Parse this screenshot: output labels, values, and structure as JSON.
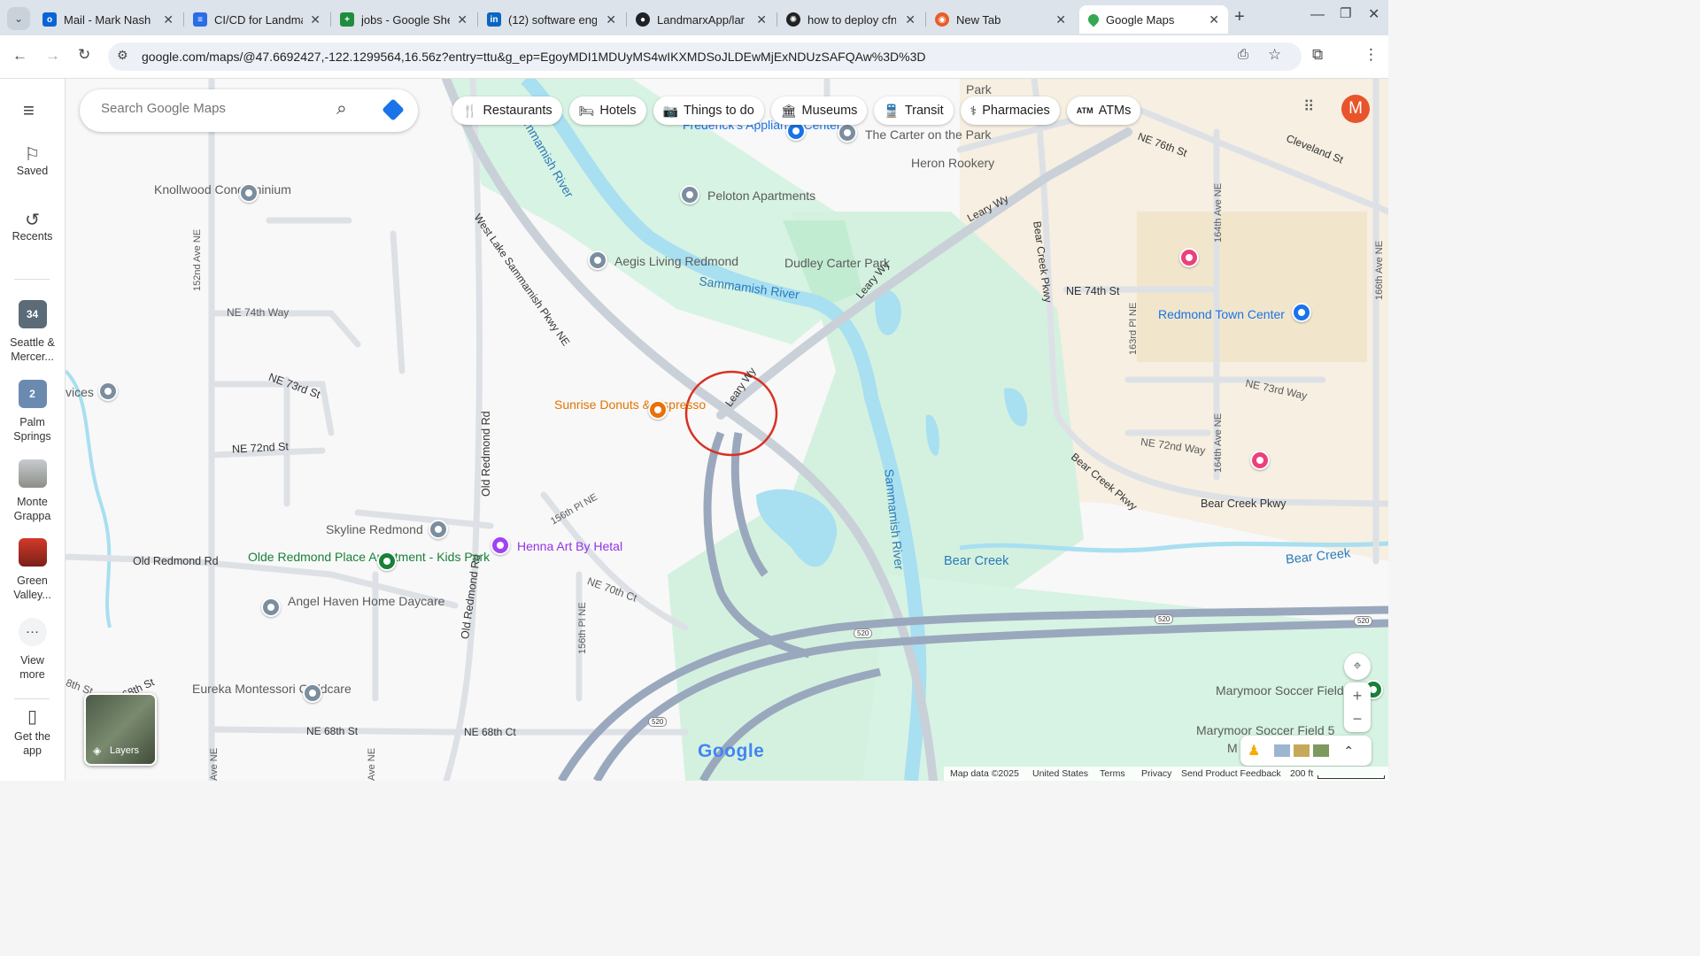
{
  "browser": {
    "tabs": [
      {
        "title": "Mail - Mark Nash",
        "icon": "outlook-icon",
        "color": "#0a64d6"
      },
      {
        "title": "CI/CD for Landma",
        "icon": "docs-icon",
        "color": "#2b6de7"
      },
      {
        "title": "jobs - Google She",
        "icon": "sheets-icon",
        "color": "#1e8e3e"
      },
      {
        "title": "(12) software eng",
        "icon": "linkedin-icon",
        "color": "#0a66c2"
      },
      {
        "title": "LandmarxApp/lar",
        "icon": "github-icon",
        "color": "#1f2328"
      },
      {
        "title": "how to deploy cfn",
        "icon": "openai-icon",
        "color": "#222222"
      },
      {
        "title": "New Tab",
        "icon": "chrome-icon",
        "color": "#e85d2a"
      },
      {
        "title": "Google Maps",
        "icon": "maps-icon",
        "color": "#34a853"
      }
    ],
    "new_tab": "+",
    "url": "google.com/maps/@47.6692427,-122.1299564,16.56z?entry=ttu&g_ep=EgoyMDI1MDUyMS4wIKXMDSoJLDEwMjExNDUzSAFQAw%3D%3D"
  },
  "rail": {
    "items": [
      {
        "label": "Saved",
        "icon": "bookmark-icon"
      },
      {
        "label": "Recents",
        "icon": "history-icon"
      },
      {
        "label": "Seattle & Mercer...",
        "count": "34",
        "color": "#5b6b78"
      },
      {
        "label": "Palm Springs",
        "count": "2",
        "color": "#6a8ab0"
      },
      {
        "label": "Monte Grappa",
        "color": "#8c8f86"
      },
      {
        "label": "Green Valley...",
        "color": "#b22222"
      },
      {
        "label": "View more",
        "icon": "more-icon"
      },
      {
        "label": "Get the app",
        "icon": "phone-icon"
      }
    ]
  },
  "search": {
    "placeholder": "Search Google Maps"
  },
  "chips": [
    "Restaurants",
    "Hotels",
    "Things to do",
    "Museums",
    "Transit",
    "Pharmacies",
    "ATMs"
  ],
  "profile": {
    "initial": "M",
    "color": "#e8542b"
  },
  "map": {
    "streets": [
      "152nd Ave NE",
      "NE 74th Way",
      "NE 73rd St",
      "NE 72nd St",
      "Old Redmond Rd",
      "Old Redmond Rd",
      "Old Redmond Rd",
      "West Lake Sammamish Pkwy NE",
      "Leary Wy",
      "Leary Wy",
      "Leary Wy",
      "156th Pl NE",
      "NE 70th Ct",
      "156th Pl NE",
      "NE 68th St",
      "NE 68th St",
      "NE 68th Ct",
      "Bear Creek Pkwy",
      "Bear Creek Pkwy",
      "Bear Creek Pkwy",
      "NE 76th St",
      "Cleveland St",
      "164th Ave NE",
      "164th Ave NE",
      "166th Ave NE",
      "NE 74th St",
      "163rd Pl NE",
      "NE 73rd Way",
      "NE 72nd Way",
      "Ave NE",
      "Ave NE",
      "8th St"
    ],
    "water": [
      "Sammamish River",
      "Sammamish River",
      "Sammamish River",
      "Bear Creek",
      "Bear Creek"
    ],
    "places": [
      "Knollwood Condominium",
      "Aegis Living Redmond",
      "Peloton Apartments",
      "Frederick's Appliance Center",
      "The Carter on the Park",
      "Heron Rookery",
      "Dudley Carter Park",
      "Sunrise Donuts & Espresso",
      "Skyline Redmond",
      "Henna Art By Hetal",
      "Olde Redmond Place Apartment - Kids Park",
      "Angel Haven Home Daycare",
      "Eureka Montessori Childcare",
      "Redmond Town Center",
      "Marymoor Soccer Field",
      "Marymoor Soccer Field 5",
      "vices",
      "Park",
      "M"
    ],
    "shields": [
      "520",
      "520",
      "520",
      "520"
    ],
    "brand": "Google",
    "layers": "Layers"
  },
  "footer": {
    "data": "Map data ©2025",
    "region": "United States",
    "terms": "Terms",
    "privacy": "Privacy",
    "feedback": "Send Product Feedback",
    "scale": "200 ft"
  }
}
